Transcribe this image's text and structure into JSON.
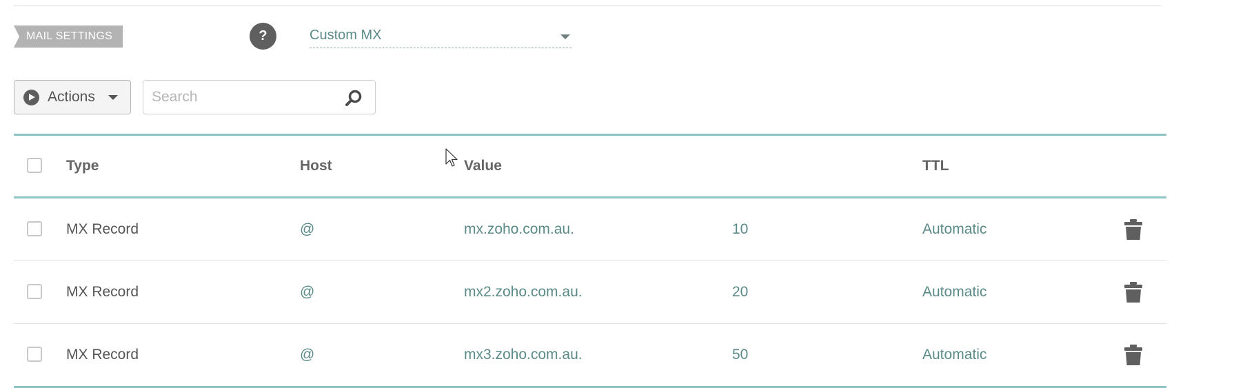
{
  "mail_settings": {
    "section_label": "MAIL SETTINGS",
    "help_label": "?",
    "mx_select": {
      "value": "Custom MX"
    }
  },
  "toolbar": {
    "actions_label": "Actions",
    "search": {
      "placeholder": "Search",
      "value": ""
    }
  },
  "table": {
    "headers": {
      "type": "Type",
      "host": "Host",
      "value": "Value",
      "ttl": "TTL"
    },
    "rows": [
      {
        "type": "MX Record",
        "host": "@",
        "value": "mx.zoho.com.au.",
        "priority": "10",
        "ttl": "Automatic"
      },
      {
        "type": "MX Record",
        "host": "@",
        "value": "mx2.zoho.com.au.",
        "priority": "20",
        "ttl": "Automatic"
      },
      {
        "type": "MX Record",
        "host": "@",
        "value": "mx3.zoho.com.au.",
        "priority": "50",
        "ttl": "Automatic"
      }
    ]
  },
  "colors": {
    "accent_teal": "#8fc2c2",
    "link_text": "#5a8a87",
    "section_tag_bg": "#b3b3b3",
    "icon_dark": "#5f5f5f"
  },
  "icons": {
    "help": "question-icon",
    "actions": "play-icon",
    "search": "search-icon",
    "delete": "trash-icon",
    "dropdown": "chevron-down-icon"
  }
}
